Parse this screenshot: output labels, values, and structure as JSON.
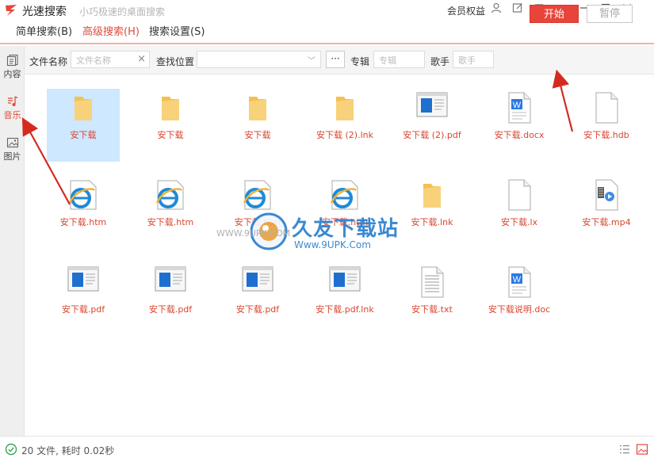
{
  "app": {
    "title": "光速搜索",
    "subtitle": "小巧极速的桌面搜索",
    "vip_label": "会员权益"
  },
  "menu": {
    "items": [
      {
        "label": "简单搜索(B)",
        "active": false
      },
      {
        "label": "高级搜索(H)",
        "active": true
      },
      {
        "label": "搜索设置(S)",
        "active": false
      }
    ]
  },
  "sidebar": {
    "items": [
      {
        "label": "内容",
        "icon": "document-icon",
        "active": false
      },
      {
        "label": "音乐",
        "icon": "music-icon",
        "active": true
      },
      {
        "label": "图片",
        "icon": "image-icon",
        "active": false
      }
    ]
  },
  "search": {
    "filename_label": "文件名称",
    "filename_placeholder": "文件名称",
    "location_label": "查找位置",
    "location_value": "",
    "more_label": "···",
    "album_label": "专辑",
    "album_placeholder": "专辑",
    "singer_label": "歌手",
    "singer_placeholder": "歌手",
    "start_label": "开始",
    "pause_label": "暂停"
  },
  "files": [
    {
      "name": "安下载",
      "type": "folder",
      "selected": true
    },
    {
      "name": "安下载",
      "type": "folder"
    },
    {
      "name": "安下载",
      "type": "folder"
    },
    {
      "name": "安下载 (2).lnk",
      "type": "folder"
    },
    {
      "name": "安下载 (2).pdf",
      "type": "pdf"
    },
    {
      "name": "安下载.docx",
      "type": "docx"
    },
    {
      "name": "安下载.hdb",
      "type": "blank"
    },
    {
      "name": "安下载.htm",
      "type": "ie"
    },
    {
      "name": "安下载.htm",
      "type": "ie"
    },
    {
      "name": "安下载.htm",
      "type": "ie"
    },
    {
      "name": "安下载.htm",
      "type": "ie"
    },
    {
      "name": "安下载.lnk",
      "type": "folder"
    },
    {
      "name": "安下载.lx",
      "type": "blank"
    },
    {
      "name": "安下载.mp4",
      "type": "mp4"
    },
    {
      "name": "安下载.pdf",
      "type": "pdf"
    },
    {
      "name": "安下载.pdf",
      "type": "pdf"
    },
    {
      "name": "安下载.pdf",
      "type": "pdf"
    },
    {
      "name": "安下载.pdf.lnk",
      "type": "pdf"
    },
    {
      "name": "安下载.txt",
      "type": "txt"
    },
    {
      "name": "安下载说明.doc",
      "type": "docx"
    }
  ],
  "watermark": {
    "title": "久友下载站",
    "url": "Www.9UPK.Com",
    "side": "WWW.9UPK.COM"
  },
  "status": {
    "text": "20 文件, 耗时 0.02秒"
  },
  "colors": {
    "accent": "#e8453a",
    "selection": "#cde8ff",
    "folder": "#f6c65b"
  }
}
